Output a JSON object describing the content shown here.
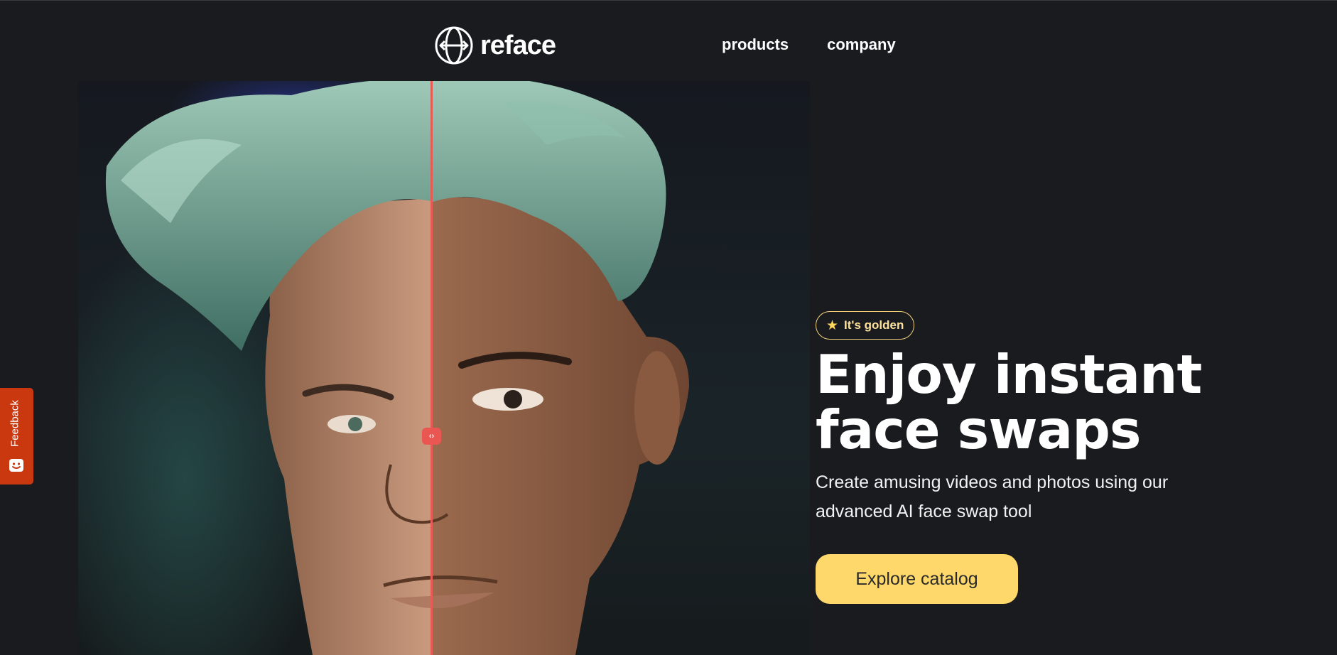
{
  "header": {
    "logo_text": "reface",
    "nav": [
      {
        "label": "products"
      },
      {
        "label": "company"
      }
    ]
  },
  "hero": {
    "badge_text": "It's golden",
    "title_line1": "Enjoy instant",
    "title_line2": "face swaps",
    "subtitle": "Create amusing videos and photos using our advanced AI face swap tool",
    "cta_label": "Explore catalog"
  },
  "feedback": {
    "label": "Feedback"
  },
  "icons": {
    "logo": "reface-logo-icon",
    "badge": "star-icon",
    "slider_handle": "chevrons-left-right-icon",
    "feedback": "smiley-icon"
  },
  "colors": {
    "background": "#1a1b1f",
    "accent_yellow": "#ffd86b",
    "badge_border": "#f4d27a",
    "slider_red": "#e95a55",
    "feedback_tab": "#c9380f"
  }
}
